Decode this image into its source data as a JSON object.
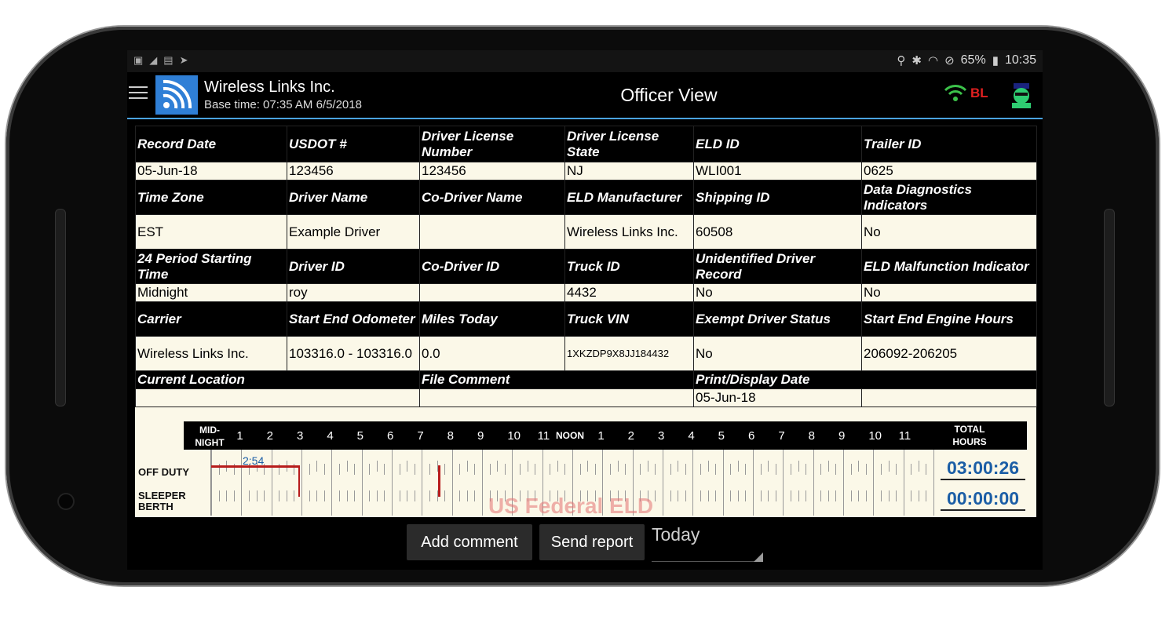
{
  "status": {
    "battery": "65%",
    "time": "10:35"
  },
  "header": {
    "company": "Wireless Links Inc.",
    "base_time": "Base time: 07:35 AM 6/5/2018",
    "title": "Officer View",
    "bl_label": "BL"
  },
  "info": {
    "r1": {
      "h": [
        "Record Date",
        "USDOT #",
        "Driver License Number",
        "Driver License State",
        "ELD ID",
        "Trailer ID"
      ],
      "v": [
        "05-Jun-18",
        "123456",
        "123456",
        "NJ",
        "WLI001",
        "0625"
      ]
    },
    "r2": {
      "h": [
        "Time Zone",
        "Driver Name",
        "Co-Driver Name",
        "ELD Manufacturer",
        "Shipping ID",
        "Data Diagnostics Indicators"
      ],
      "v": [
        "EST",
        "Example Driver",
        "",
        "Wireless Links Inc.",
        "60508",
        "No"
      ]
    },
    "r3": {
      "h": [
        "24 Period Starting Time",
        "Driver ID",
        "Co-Driver ID",
        "Truck ID",
        "Unidentified Driver Record",
        "ELD Malfunction Indicator"
      ],
      "v": [
        "Midnight",
        "roy",
        "",
        "4432",
        "No",
        "No"
      ]
    },
    "r4": {
      "h": [
        "Carrier",
        "Start End Odometer",
        "Miles Today",
        "Truck VIN",
        "Exempt Driver Status",
        "Start End Engine Hours"
      ],
      "v": [
        "Wireless Links Inc.",
        "103316.0 - 103316.0",
        "0.0",
        "1XKZDP9X8JJ184432",
        "No",
        "206092-206205"
      ]
    },
    "r5": {
      "h": [
        "Current Location",
        "File Comment",
        "Print/Display Date"
      ],
      "v": [
        "",
        "",
        "05-Jun-18",
        ""
      ]
    }
  },
  "grid": {
    "midnight_label": "MID-NIGHT",
    "noon_label": "NOON",
    "total_label": "TOTAL HOURS",
    "hours_am": [
      "1",
      "2",
      "3",
      "4",
      "5",
      "6",
      "7",
      "8",
      "9",
      "10",
      "11"
    ],
    "hours_pm": [
      "1",
      "2",
      "3",
      "4",
      "5",
      "6",
      "7",
      "8",
      "9",
      "10",
      "11"
    ],
    "rows": [
      "OFF DUTY",
      "SLEEPER BERTH"
    ],
    "off_duty_label": "2:54",
    "totals": [
      "03:00:26",
      "00:00:00"
    ],
    "watermark": "US Federal ELD",
    "off_duty_periods": [
      {
        "start_hour": 0.0,
        "end_hour": 2.9
      },
      {
        "start_hour": 7.55,
        "end_hour": 7.6
      }
    ]
  },
  "actions": {
    "add_comment": "Add comment",
    "send_report": "Send report",
    "day_select": "Today"
  }
}
